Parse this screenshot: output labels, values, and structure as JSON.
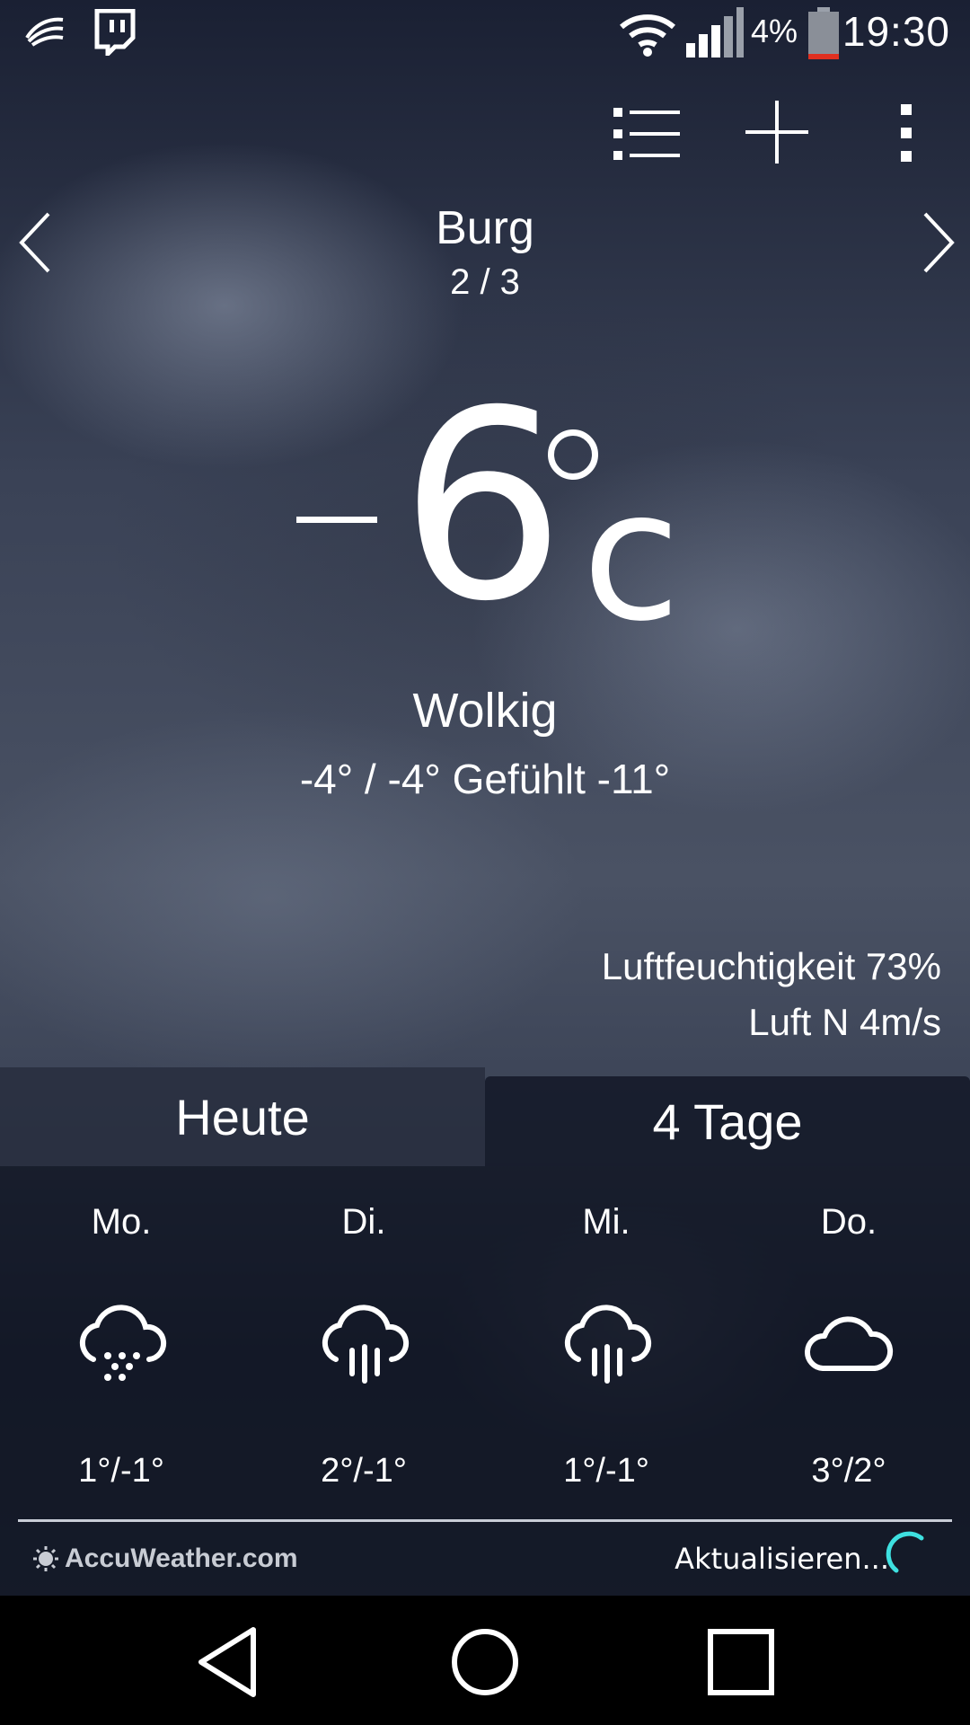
{
  "status_bar": {
    "time": "19:30",
    "battery_percent": "4%",
    "icons": [
      "swiftkey-icon",
      "twitch-icon",
      "wifi-icon",
      "signal-icon",
      "battery-icon"
    ]
  },
  "toolbar": {
    "actions": [
      "list-icon",
      "add-icon",
      "more-vert-icon"
    ]
  },
  "location": {
    "city": "Burg",
    "page_indicator": "2 / 3"
  },
  "current": {
    "temp_value": "6",
    "temp_unit": "c",
    "condition": "Wolkig",
    "minmax": "-4° / -4° Gefühlt -11°",
    "humidity": "Luftfeuchtigkeit 73%",
    "wind": "Luft N 4m/s"
  },
  "tabs": {
    "today": "Heute",
    "days4": "4 Tage"
  },
  "forecast": [
    {
      "day": "Mo.",
      "icon": "snow-cloud-icon",
      "temp": "1°/-1°"
    },
    {
      "day": "Di.",
      "icon": "rain-cloud-icon",
      "temp": "2°/-1°"
    },
    {
      "day": "Mi.",
      "icon": "rain-cloud-icon",
      "temp": "1°/-1°"
    },
    {
      "day": "Do.",
      "icon": "cloud-icon",
      "temp": "3°/2°"
    }
  ],
  "footer": {
    "brand": "AccuWeather.com",
    "refresh_label": "Aktualisieren...",
    "accent_color": "#3ee0e0"
  }
}
